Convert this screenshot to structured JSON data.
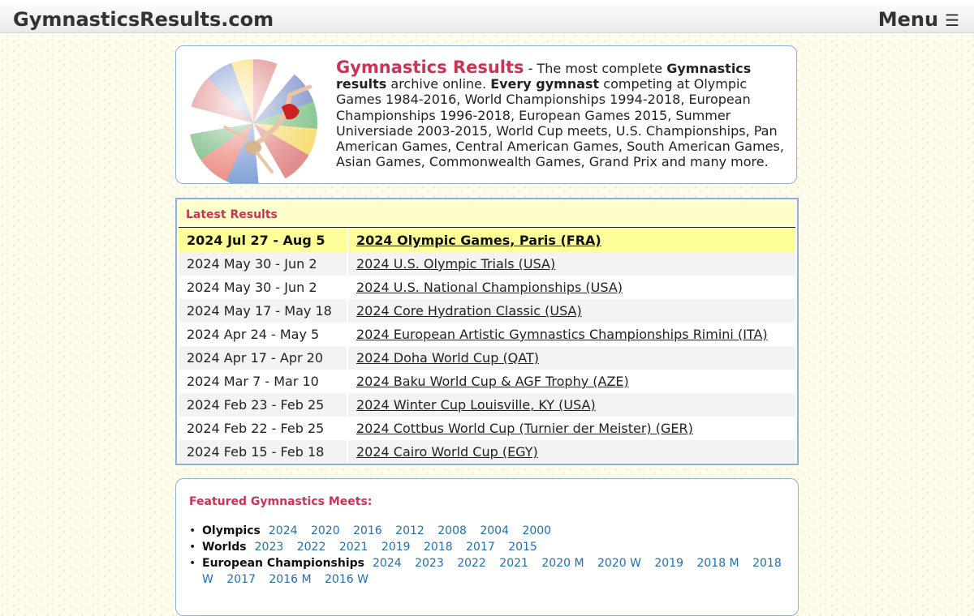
{
  "site": {
    "title": "GymnasticsResults.com",
    "menu_label": "Menu",
    "menu_icon": "hamburger-icon"
  },
  "intro": {
    "brand": "Gymnastics Results",
    "p1": " - The most complete ",
    "b1": "Gymnastics results",
    "p2": " archive online. ",
    "b2": "Every gymnast",
    "p3": " competing at Olympic Games 1984-2016, World Championships 1994-2018, European Championships 1996-2018, European Games 2015, Summer Universiade 2003-2015, World Cup meets, U.S. Championships, Pan American Games, Central American Games, South American Games, Asian Games, Commonwealth Games, Grand Prix and many more."
  },
  "latest": {
    "heading": "Latest Results",
    "rows": [
      {
        "date": "2024 Jul 27 - Aug 5",
        "event": "2024 Olympic Games, Paris (FRA)"
      },
      {
        "date": "2024 May 30 - Jun 2",
        "event": "2024 U.S. Olympic Trials (USA)"
      },
      {
        "date": "2024 May 30 - Jun 2",
        "event": "2024 U.S. National Championships (USA)"
      },
      {
        "date": "2024 May 17 - May 18",
        "event": "2024 Core Hydration Classic (USA)"
      },
      {
        "date": "2024 Apr 24 - May 5",
        "event": "2024 European Artistic Gymnastics Championships Rimini (ITA)"
      },
      {
        "date": "2024 Apr 17 - Apr 20",
        "event": "2024 Doha World Cup (QAT)"
      },
      {
        "date": "2024 Mar 7 - Mar 10",
        "event": "2024 Baku World Cup & AGF Trophy (AZE)"
      },
      {
        "date": "2024 Feb 23 - Feb 25",
        "event": "2024 Winter Cup Louisville, KY (USA)"
      },
      {
        "date": "2024 Feb 22 - Feb 25",
        "event": "2024 Cottbus World Cup (Turnier der Meister) (GER)"
      },
      {
        "date": "2024 Feb 15 - Feb 18",
        "event": "2024 Cairo World Cup (EGY)"
      }
    ]
  },
  "featured": {
    "title": "Featured Gymnastics Meets:",
    "meets": [
      {
        "name": "Olympics",
        "years": [
          "2024",
          "2020",
          "2016",
          "2012",
          "2008",
          "2004",
          "2000"
        ]
      },
      {
        "name": "Worlds",
        "years": [
          "2023",
          "2022",
          "2021",
          "2019",
          "2018",
          "2017",
          "2015"
        ]
      },
      {
        "name": "European Championships",
        "years": [
          "2024",
          "2023",
          "2022",
          "2021",
          "2020 M",
          "2020 W",
          "2019",
          "2018 M",
          "2018 W",
          "2017",
          "2016 M",
          "2016 W"
        ]
      }
    ]
  },
  "colors": {
    "accent": "#cc3355",
    "link": "#1f6fb2",
    "highlight_row": "#ffff99",
    "heading_bg": "#ffffcc",
    "border": "#8fb0d8"
  }
}
